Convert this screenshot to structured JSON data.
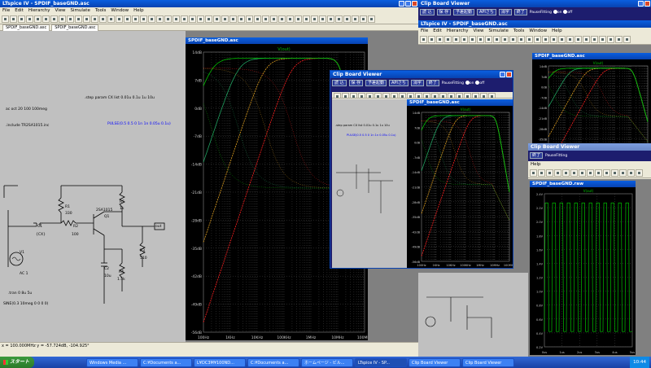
{
  "main_window": {
    "title": "LTspice IV - SPDIF_baseGND.asc",
    "menu": [
      "File",
      "Edit",
      "Hierarchy",
      "View",
      "Simulate",
      "Tools",
      "Window",
      "Help"
    ],
    "tab": "SPDIF_baseGND.asc",
    "tab2": "SPDIF_baseGND.asc",
    "plot_title": "SPDIF_baseGND.asc",
    "status": "x = 100.000MHz   y = -57.724dB, -104.925°"
  },
  "schematic": {
    "ac_cmd": "ac oct 20 100 100meg",
    "step_cmd": ".step param CX list 0.01u 0.1u 1u 10u",
    "include_cmd": ".include TR2SA1015.inc",
    "pulse": "PULSE(0.5 0.5 0 1n 1n 0.05u 0.1u)",
    "r1": "R1",
    "r1v": "330",
    "r2": "R2",
    "r2v": "100",
    "c1": "C1",
    "c1v": "{CX}",
    "c2": "C2",
    "c2v": "10u",
    "q1": "Q1",
    "q1v": "2SA1015",
    "r3": "R3",
    "r3v": "510",
    "r4": "R4",
    "r4v": "1.5k",
    "r5": "R5",
    "r5v": "1k",
    "v1": "V1",
    "v1v": "AC 1",
    "out": "out",
    "tran": ".tran 0 8u 5u",
    "sine": "SINE(0.3 10meg 0 0 0 0)"
  },
  "plot": {
    "trace": "V(out)",
    "y_ticks": [
      "14dB",
      "7dB",
      "0dB",
      "-7dB",
      "-14dB",
      "-21dB",
      "-28dB",
      "-35dB",
      "-42dB",
      "-49dB",
      "-56dB"
    ],
    "x_ticks": [
      "100Hz",
      "1KHz",
      "10KHz",
      "100KHz",
      "1MHz",
      "10MHz",
      "100MHz"
    ]
  },
  "clipboard_viewer": {
    "title": "Clip Board Viewer",
    "buttons": [
      "読 込",
      "保 存",
      "予差起動",
      "APIさち",
      "消字",
      "終了"
    ],
    "pause_label": "PauseFitting",
    "on": "on",
    "off": "off"
  },
  "nested": {
    "title": "LTspice IV - SPDIF_baseGND.asc",
    "plot_title": "SPDIF_baseGND.asc",
    "trace": "V(out)",
    "raw_title": "SPDIF_baseGND.raw",
    "raw_trace": "V(out)",
    "raw_y": [
      "2.4V",
      "2.2V",
      "2.0V",
      "1.8V",
      "1.6V",
      "1.4V",
      "1.2V",
      "1.0V",
      "0.8V",
      "0.6V",
      "0.4V",
      "0.2V"
    ],
    "raw_x": [
      "0us",
      "1us",
      "2us",
      "3us",
      "4us",
      "5us"
    ],
    "help": "Help"
  },
  "taskbar": {
    "start": "スタート",
    "items": [
      "Windows Media ...",
      "C:¥Documents a...",
      "L¥DC3M¥100ND...",
      "C:¥Documents a...",
      "ホームページ - ビル...",
      "LTspice IV - SP...",
      "Clip Board Viewer",
      "Clip Board Viewer"
    ],
    "clock": "10:44"
  },
  "colors": {
    "green": "#00c000",
    "red": "#ff2020",
    "orange": "#e0a020",
    "darkgreen": "#20a060"
  }
}
